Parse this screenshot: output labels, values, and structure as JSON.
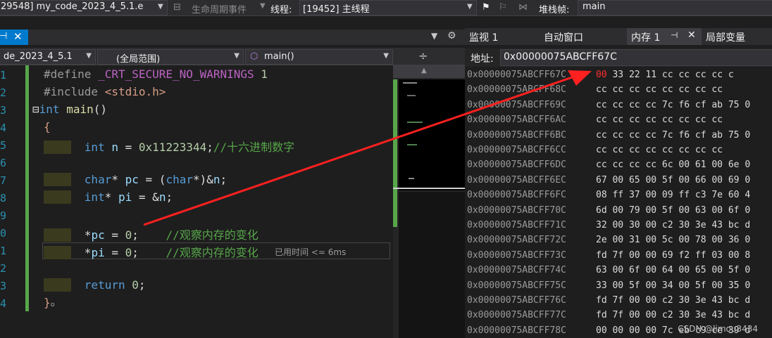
{
  "toolbar": {
    "process": "29548] my_code_2023_4_5.1.e",
    "lifecycle": "生命周期事件",
    "thread_label": "线程:",
    "thread_value": "[19452] 主线程",
    "stackframe_label": "堆栈帧:",
    "stackframe_value": "main"
  },
  "editor": {
    "nav_file": "de_2023_4_5.1",
    "nav_scope": "(全局范围)",
    "nav_func": "main()",
    "line_numbers": [
      "1",
      "2",
      "3",
      "4",
      "5",
      "6",
      "7",
      "8",
      "9",
      "0",
      "1",
      "2",
      "3",
      "4"
    ],
    "perf_tip": "已用时间 <= 6ms"
  },
  "memory": {
    "tabs": [
      "监视 1",
      "自动窗口",
      "内存 1",
      "局部变量"
    ],
    "address_label": "地址:",
    "address_value": "0x00000075ABCFF67C",
    "rows": [
      {
        "addr": "0x00000075ABCFF67C",
        "bytes": " 33 22 11 cc cc cc cc c"
      },
      {
        "addr": "0x00000075ABCFF68C",
        "bytes": "cc cc cc cc cc cc cc cc"
      },
      {
        "addr": "0x00000075ABCFF69C",
        "bytes": "cc cc cc cc 7c f6 cf ab 75 0"
      },
      {
        "addr": "0x00000075ABCFF6AC",
        "bytes": "cc cc cc cc cc cc cc cc"
      },
      {
        "addr": "0x00000075ABCFF6BC",
        "bytes": "cc cc cc cc 7c f6 cf ab 75 0"
      },
      {
        "addr": "0x00000075ABCFF6CC",
        "bytes": "cc cc cc cc cc cc cc cc"
      },
      {
        "addr": "0x00000075ABCFF6DC",
        "bytes": "cc cc cc cc 6c 00 61 00 6e 0"
      },
      {
        "addr": "0x00000075ABCFF6EC",
        "bytes": "67 00 65 00 5f 00 66 00 69 0"
      },
      {
        "addr": "0x00000075ABCFF6FC",
        "bytes": "08 ff 37 00 09 ff c3 7e 60 4"
      },
      {
        "addr": "0x00000075ABCFF70C",
        "bytes": "6d 00 79 00 5f 00 63 00 6f 0"
      },
      {
        "addr": "0x00000075ABCFF71C",
        "bytes": "32 00 30 00 c2 30 3e 43 bc d"
      },
      {
        "addr": "0x00000075ABCFF72C",
        "bytes": "2e 00 31 00 5c 00 78 00 36 0"
      },
      {
        "addr": "0x00000075ABCFF73C",
        "bytes": "fd 7f 00 00 69 f2 ff 03 00 8"
      },
      {
        "addr": "0x00000075ABCFF74C",
        "bytes": "63 00 6f 00 64 00 65 00 5f 0"
      },
      {
        "addr": "0x00000075ABCFF75C",
        "bytes": "33 00 5f 00 34 00 5f 00 35 0"
      },
      {
        "addr": "0x00000075ABCFF76C",
        "bytes": "fd 7f 00 00 c2 30 3e 43 bc d"
      },
      {
        "addr": "0x00000075ABCFF77C",
        "bytes": "fd 7f 00 00 c2 30 3e 43 bc d"
      },
      {
        "addr": "0x00000075ABCFF78C",
        "bytes": "00 00 00 00 7c eb c9 ce 39 d"
      }
    ],
    "changed_byte": "00"
  },
  "watermark": "CSDN @limou3434",
  "colors": {
    "arrow": "#ff2020",
    "accent": "#007acc"
  }
}
